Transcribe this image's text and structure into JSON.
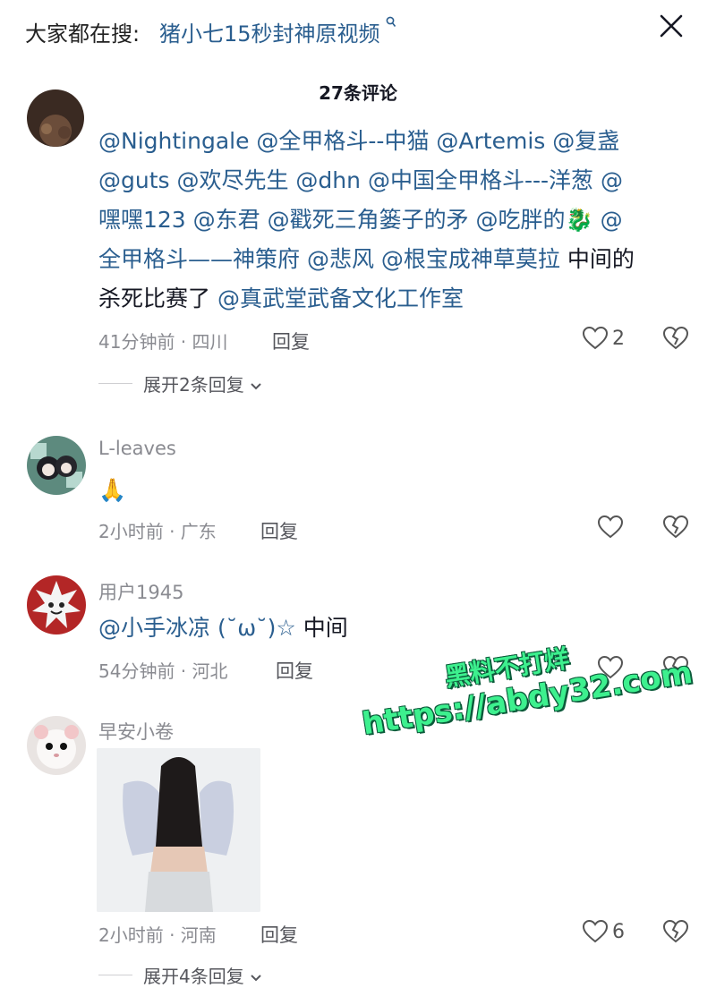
{
  "header": {
    "search_prefix": "大家都在搜:",
    "search_term": "猪小七15秒封神原视频",
    "search_icon": "search-icon",
    "close_icon": "close-icon",
    "comments_title": "27条评论"
  },
  "comments": [
    {
      "avatar": "avatar-partial",
      "text_lines": [
        [
          {
            "t": "@Nightingale @全甲格斗--中猫  @Artemis @复盏",
            "m": true
          }
        ],
        [
          {
            "t": "@guts @欢尽先生  @dhn @中国全甲格斗---洋葱  @",
            "m": true
          }
        ],
        [
          {
            "t": "嘿嘿123 @东君  @戳死三角篓子的矛  @吃胖的🐉 @",
            "m": true
          }
        ],
        [
          {
            "t": "全甲格斗——神策府  @悲风  @根宝成神草莫拉",
            "m": true
          },
          {
            "t": " 中间的",
            "m": false
          }
        ],
        [
          {
            "t": "杀死比赛了 ",
            "m": false
          },
          {
            "t": "@真武堂武备文化工作室",
            "m": true
          }
        ]
      ],
      "meta": "41分钟前 · 四川",
      "reply_label": "回复",
      "likes": "2",
      "expand_label": "展开2条回复"
    },
    {
      "username": "L-leaves",
      "avatar": "avatar-anime",
      "text": "🙏",
      "meta": "2小时前 · 广东",
      "reply_label": "回复",
      "likes": ""
    },
    {
      "username": "用户1945",
      "avatar": "avatar-cartoon",
      "text_mention": "@小手冰凉 (˘ω˘)☆",
      "text_plain": " 中间",
      "meta": "54分钟前 · 河北",
      "reply_label": "回复",
      "likes": ""
    },
    {
      "username": "早安小卷",
      "avatar": "avatar-hamster",
      "meta": "2小时前 · 河南",
      "reply_label": "回复",
      "likes": "6",
      "expand_label": "展开4条回复"
    }
  ],
  "watermark": {
    "line1": "黑料不打烊",
    "line2": "https://abdy32.com"
  },
  "colors": {
    "mention": "#2a5e8f",
    "meta": "#8a8b91",
    "watermark": "#3df08e"
  }
}
